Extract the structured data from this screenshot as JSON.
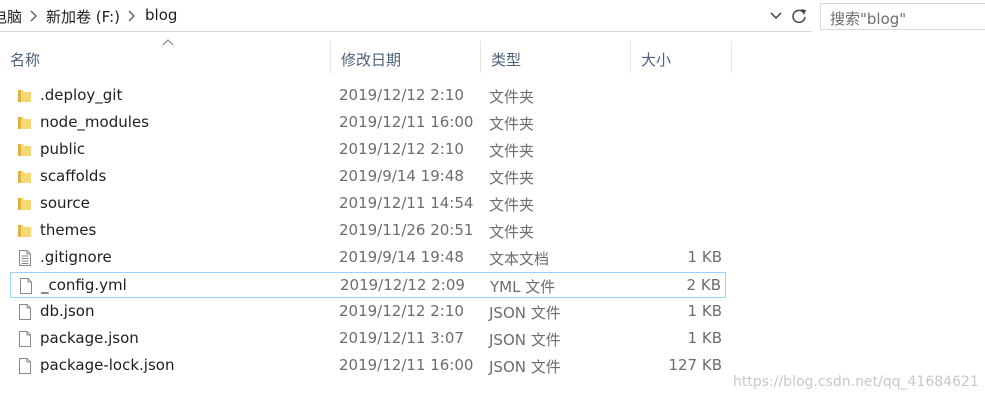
{
  "breadcrumb": {
    "items": [
      "电脑",
      "新加卷 (F:)",
      "blog"
    ]
  },
  "search": {
    "placeholder": "搜索\"blog\""
  },
  "columns": {
    "name": "名称",
    "date": "修改日期",
    "type": "类型",
    "size": "大小"
  },
  "files": [
    {
      "icon": "folder-icon",
      "name": ".deploy_git",
      "date": "2019/12/12 2:10",
      "type": "文件夹",
      "size": ""
    },
    {
      "icon": "folder-icon",
      "name": "node_modules",
      "date": "2019/12/11 16:00",
      "type": "文件夹",
      "size": ""
    },
    {
      "icon": "folder-icon",
      "name": "public",
      "date": "2019/12/12 2:10",
      "type": "文件夹",
      "size": ""
    },
    {
      "icon": "folder-icon",
      "name": "scaffolds",
      "date": "2019/9/14 19:48",
      "type": "文件夹",
      "size": ""
    },
    {
      "icon": "folder-icon",
      "name": "source",
      "date": "2019/12/11 14:54",
      "type": "文件夹",
      "size": ""
    },
    {
      "icon": "folder-icon",
      "name": "themes",
      "date": "2019/11/26 20:51",
      "type": "文件夹",
      "size": ""
    },
    {
      "icon": "text-file-icon",
      "name": ".gitignore",
      "date": "2019/9/14 19:48",
      "type": "文本文档",
      "size": "1 KB"
    },
    {
      "icon": "file-icon",
      "name": "_config.yml",
      "date": "2019/12/12 2:09",
      "type": "YML 文件",
      "size": "2 KB",
      "selected": true
    },
    {
      "icon": "file-icon",
      "name": "db.json",
      "date": "2019/12/12 2:10",
      "type": "JSON 文件",
      "size": "1 KB"
    },
    {
      "icon": "file-icon",
      "name": "package.json",
      "date": "2019/12/11 3:07",
      "type": "JSON 文件",
      "size": "1 KB"
    },
    {
      "icon": "file-icon",
      "name": "package-lock.json",
      "date": "2019/12/11 16:00",
      "type": "JSON 文件",
      "size": "127 KB"
    }
  ],
  "watermark": "https://blog.csdn.net/qq_41684621",
  "colors": {
    "folder": "#f8d775",
    "folder_dark": "#e0b040",
    "selection_border": "#99d1ff",
    "header_text": "#4c607a"
  }
}
